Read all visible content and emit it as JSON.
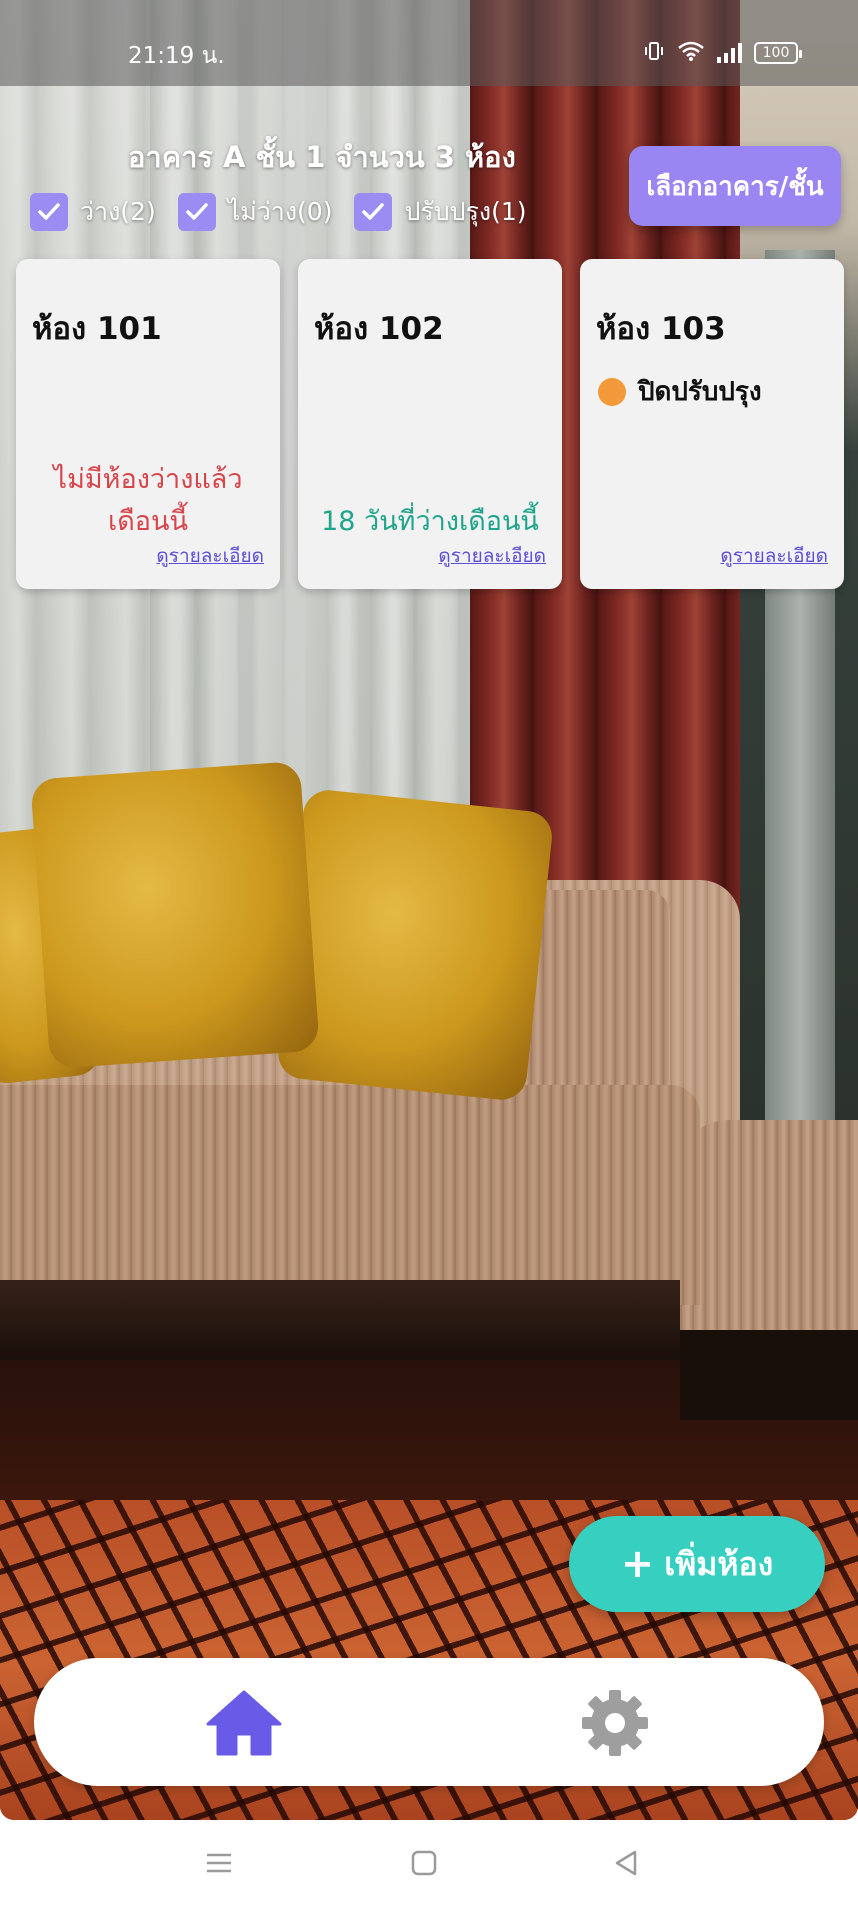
{
  "status_bar": {
    "time": "21:19 น.",
    "battery": "100",
    "icons": [
      "vibrate-icon",
      "wifi-icon",
      "signal-icon",
      "battery-icon"
    ]
  },
  "header": {
    "title": "อาคาร A ชั้น 1 จำนวน 3 ห้อง",
    "select_button": "เลือกอาคาร/ชั้น"
  },
  "filters": [
    {
      "label": "ว่าง(2)",
      "checked": true
    },
    {
      "label": "ไม่ว่าง(0)",
      "checked": true
    },
    {
      "label": "ปรับปรุง(1)",
      "checked": true
    }
  ],
  "rooms": [
    {
      "name": "ห้อง 101",
      "status": "ไม่มีห้องว่างแล้วเดือนนี้",
      "link": "ดูรายละเอียด"
    },
    {
      "name": "ห้อง 102",
      "status": "18 วันที่ว่างเดือนนี้",
      "link": "ดูรายละเอียด"
    },
    {
      "name": "ห้อง 103",
      "maintenance": "ปิดปรับปรุง",
      "link": "ดูรายละเอียด"
    }
  ],
  "fab": {
    "plus": "+",
    "label": "เพิ่มห้อง"
  },
  "colors": {
    "accent": "#9a86f2",
    "fab": "#36cfc0",
    "nav_active": "#6a5ae8",
    "nav_inactive": "#9e9e9e",
    "status_red": "#d9434a",
    "status_teal": "#1fa58c",
    "maintenance_dot": "#f29a3a"
  },
  "bottom_nav": {
    "items": [
      {
        "icon": "home-icon",
        "active": true
      },
      {
        "icon": "gear-icon",
        "active": false
      }
    ]
  },
  "system_nav": {
    "icons": [
      "menu-icon",
      "home-square-icon",
      "back-icon"
    ]
  }
}
